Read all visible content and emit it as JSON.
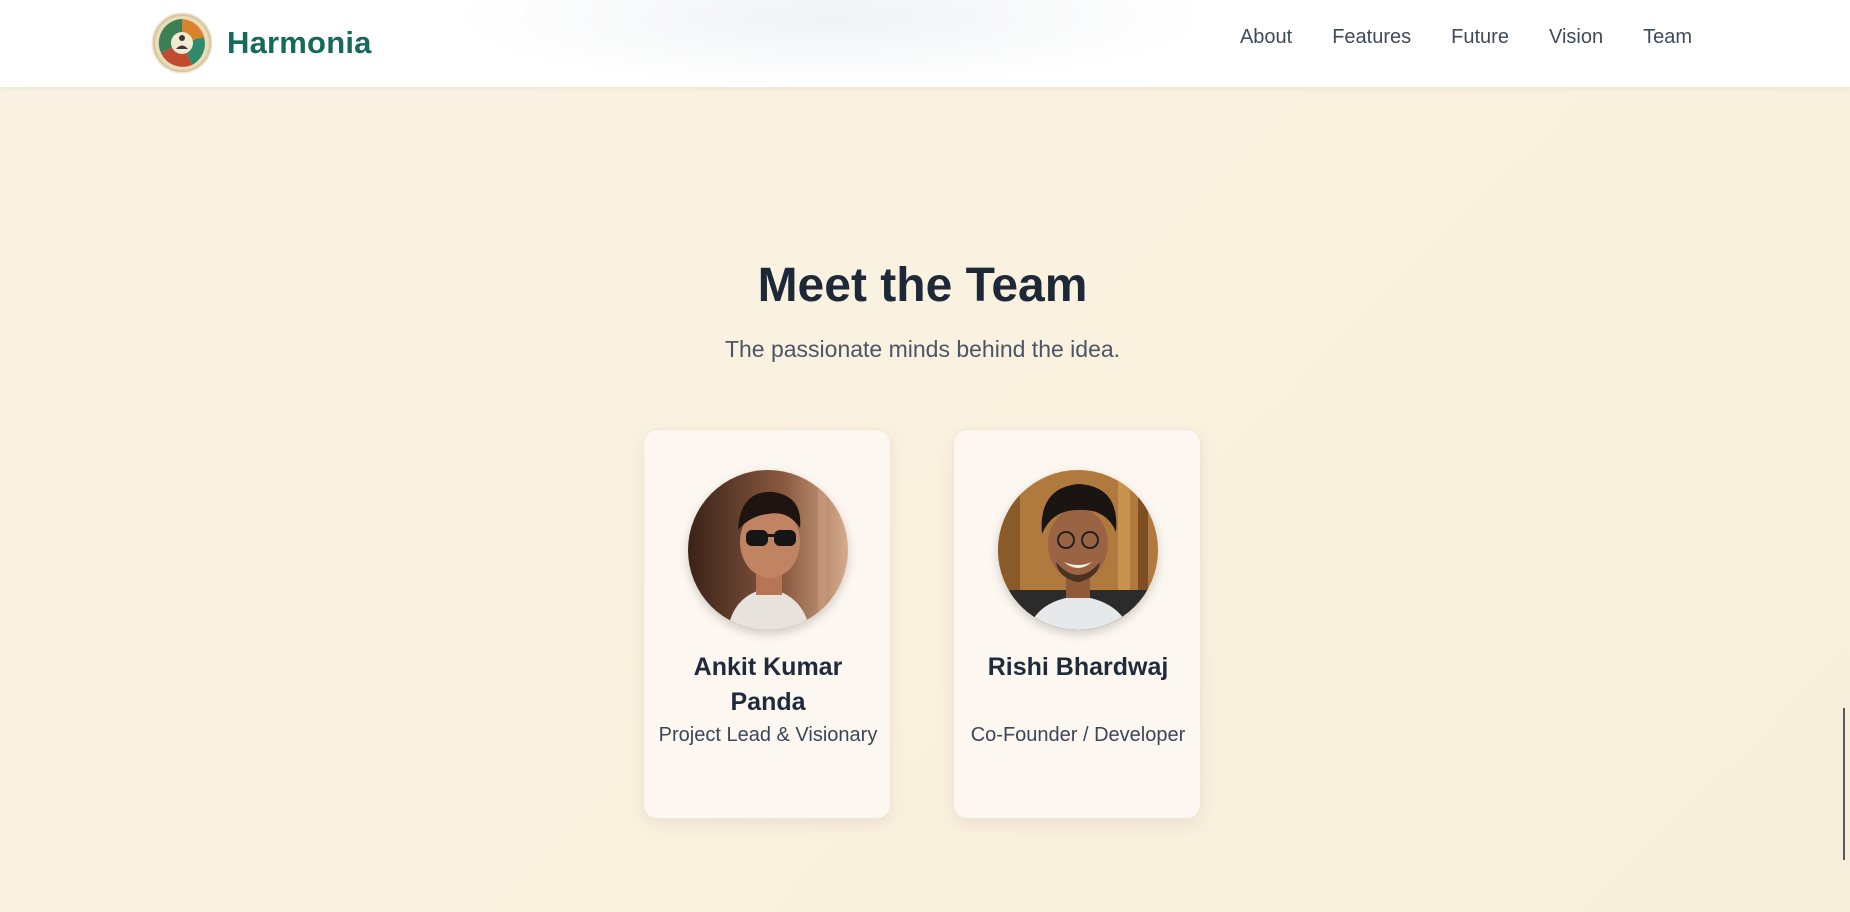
{
  "header": {
    "brand": "Harmonia",
    "logo_icon": "harmonia-logo-icon",
    "nav": [
      "About",
      "Features",
      "Future",
      "Vision",
      "Team"
    ]
  },
  "team": {
    "title": "Meet the Team",
    "subtitle": "The passionate minds behind the idea.",
    "members": [
      {
        "name": "Ankit Kumar Panda",
        "role": "Project Lead & Visionary",
        "photo": "member-photo"
      },
      {
        "name": "Rishi Bhardwaj",
        "role": "Co-Founder / Developer",
        "photo": "member-photo"
      }
    ]
  },
  "colors": {
    "brand": "#17695b",
    "background": "#faf3e4",
    "heading": "#1d2838",
    "nav_text": "#3f4a5a"
  }
}
